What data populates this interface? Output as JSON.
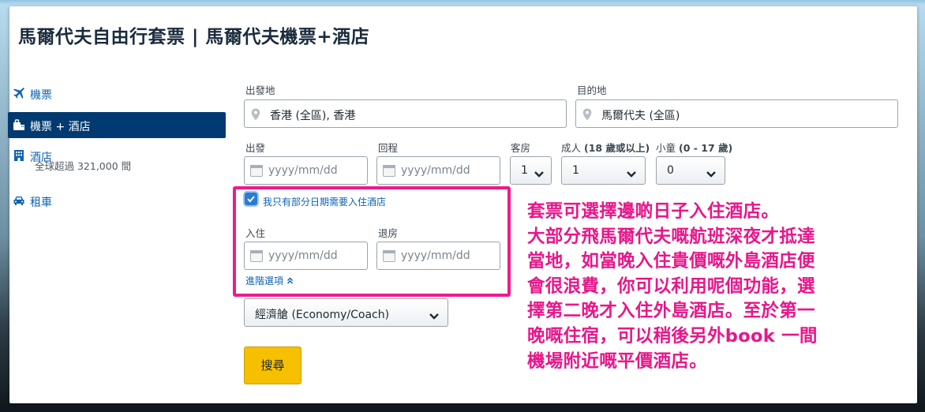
{
  "page_title": "馬爾代夫自由行套票 | 馬爾代夫機票+酒店",
  "sidebar": {
    "items": [
      {
        "label": "機票",
        "icon": "airplane-icon"
      },
      {
        "label": "機票 + 酒店",
        "icon": "luggage-icon",
        "active": true
      },
      {
        "label": "酒店",
        "icon": "building-icon",
        "sub": "全球超過 321,000 間"
      },
      {
        "label": "租車",
        "icon": "car-icon"
      }
    ]
  },
  "form": {
    "origin": {
      "label": "出發地",
      "value": "香港 (全區), 香港"
    },
    "destination": {
      "label": "目的地",
      "value": "馬爾代夫 (全區)"
    },
    "depart": {
      "label": "出發",
      "placeholder": "yyyy/mm/dd"
    },
    "return": {
      "label": "回程",
      "placeholder": "yyyy/mm/dd"
    },
    "rooms": {
      "label": "客房",
      "value": "1"
    },
    "adults": {
      "label_main": "成人 ",
      "label_bold": "(18 歲或以上)",
      "value": "1"
    },
    "children": {
      "label_main": "小童 ",
      "label_bold": "(0 - 17 歲)",
      "value": "0"
    },
    "partial_hotel_checkbox": {
      "label": "我只有部分日期需要入住酒店",
      "checked": true
    },
    "checkin": {
      "label": "入住",
      "placeholder": "yyyy/mm/dd"
    },
    "checkout": {
      "label": "退房",
      "placeholder": "yyyy/mm/dd"
    },
    "advanced_options": "進階選項",
    "cabin_class": "經濟艙 (Economy/Coach)",
    "search_button": "搜尋"
  },
  "annotation": {
    "color": "#e8168a",
    "lines": [
      "套票可選擇邊啲日子入住酒店。",
      "大部分飛馬爾代夫嘅航班深夜才抵達",
      "當地，如當晚入住貴價嘅外島酒店便",
      "會很浪費，你可以利用呢個功能，選",
      "擇第二晚才入住外島酒店。至於第一",
      "晚嘅住宿，可以稍後另外book 一間",
      "機場附近嘅平價酒店。"
    ]
  },
  "colors": {
    "link_blue": "#0d63b5",
    "active_nav": "#003a70",
    "search_button": "#f6c000",
    "highlight_box": "#ee1a8c"
  }
}
